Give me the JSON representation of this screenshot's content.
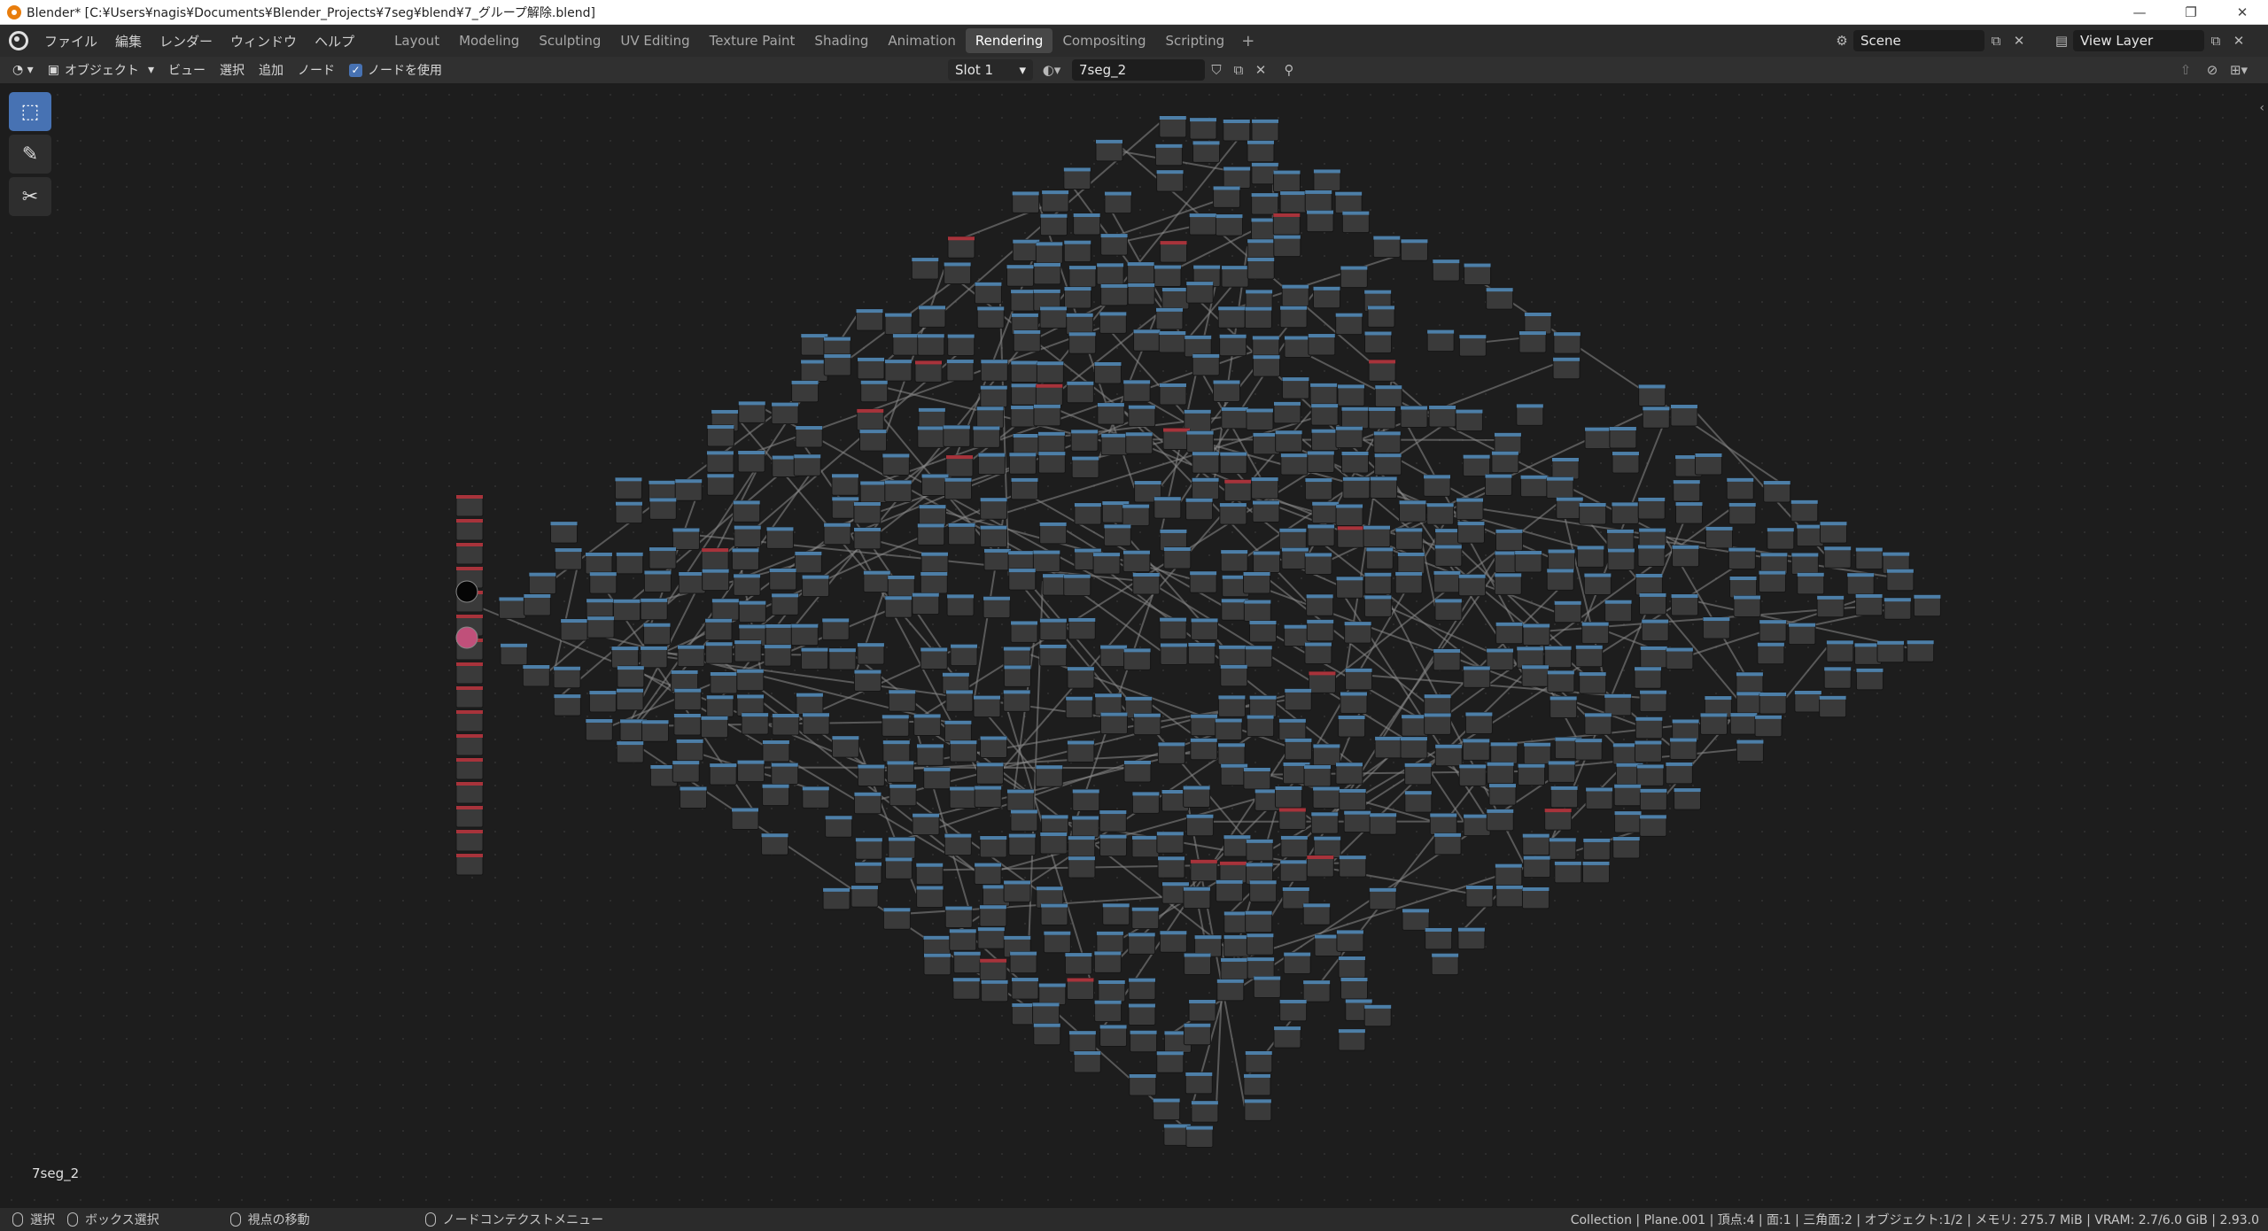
{
  "window": {
    "title": "Blender* [C:¥Users¥nagis¥Documents¥Blender_Projects¥7seg¥blend¥7_グループ解除.blend]",
    "controls": [
      "—",
      "❐",
      "✕"
    ]
  },
  "menu": [
    "ファイル",
    "編集",
    "レンダー",
    "ウィンドウ",
    "ヘルプ"
  ],
  "workspaces": [
    {
      "label": "Layout",
      "active": false
    },
    {
      "label": "Modeling",
      "active": false
    },
    {
      "label": "Sculpting",
      "active": false
    },
    {
      "label": "UV Editing",
      "active": false
    },
    {
      "label": "Texture Paint",
      "active": false
    },
    {
      "label": "Shading",
      "active": false
    },
    {
      "label": "Animation",
      "active": false
    },
    {
      "label": "Rendering",
      "active": true
    },
    {
      "label": "Compositing",
      "active": false
    },
    {
      "label": "Scripting",
      "active": false
    }
  ],
  "add_workspace": "+",
  "scene": {
    "name": "Scene"
  },
  "view_layer": {
    "name": "View Layer"
  },
  "header": {
    "mode": "オブジェクト",
    "view": "ビュー",
    "select": "選択",
    "add": "追加",
    "node": "ノード",
    "use_nodes_label": "ノードを使用",
    "use_nodes": true,
    "slot": "Slot 1",
    "material": "7seg_2"
  },
  "editor": {
    "node_tree_name": "7seg_2",
    "colors": {
      "node_header": "#4d7fa8",
      "node_body": "#3a3a3a",
      "link": "#8a8a8a",
      "input_header": "#a8333b",
      "group_header": "#4e8a3e"
    }
  },
  "tools": [
    {
      "icon": "select-box-icon",
      "active": true
    },
    {
      "icon": "annotate-icon",
      "active": false
    },
    {
      "icon": "links-cut-icon",
      "active": false
    }
  ],
  "statusbar": {
    "left": [
      {
        "label": "選択"
      },
      {
        "label": "ボックス選択"
      },
      {
        "label": "視点の移動"
      },
      {
        "label": "ノードコンテクストメニュー"
      }
    ],
    "stats": "Collection | Plane.001 | 頂点:4 | 面:1 | 三角面:2 | オブジェクト:1/2 | メモリ: 275.7 MiB | VRAM: 2.7/6.0 GiB | 2.93.0"
  }
}
